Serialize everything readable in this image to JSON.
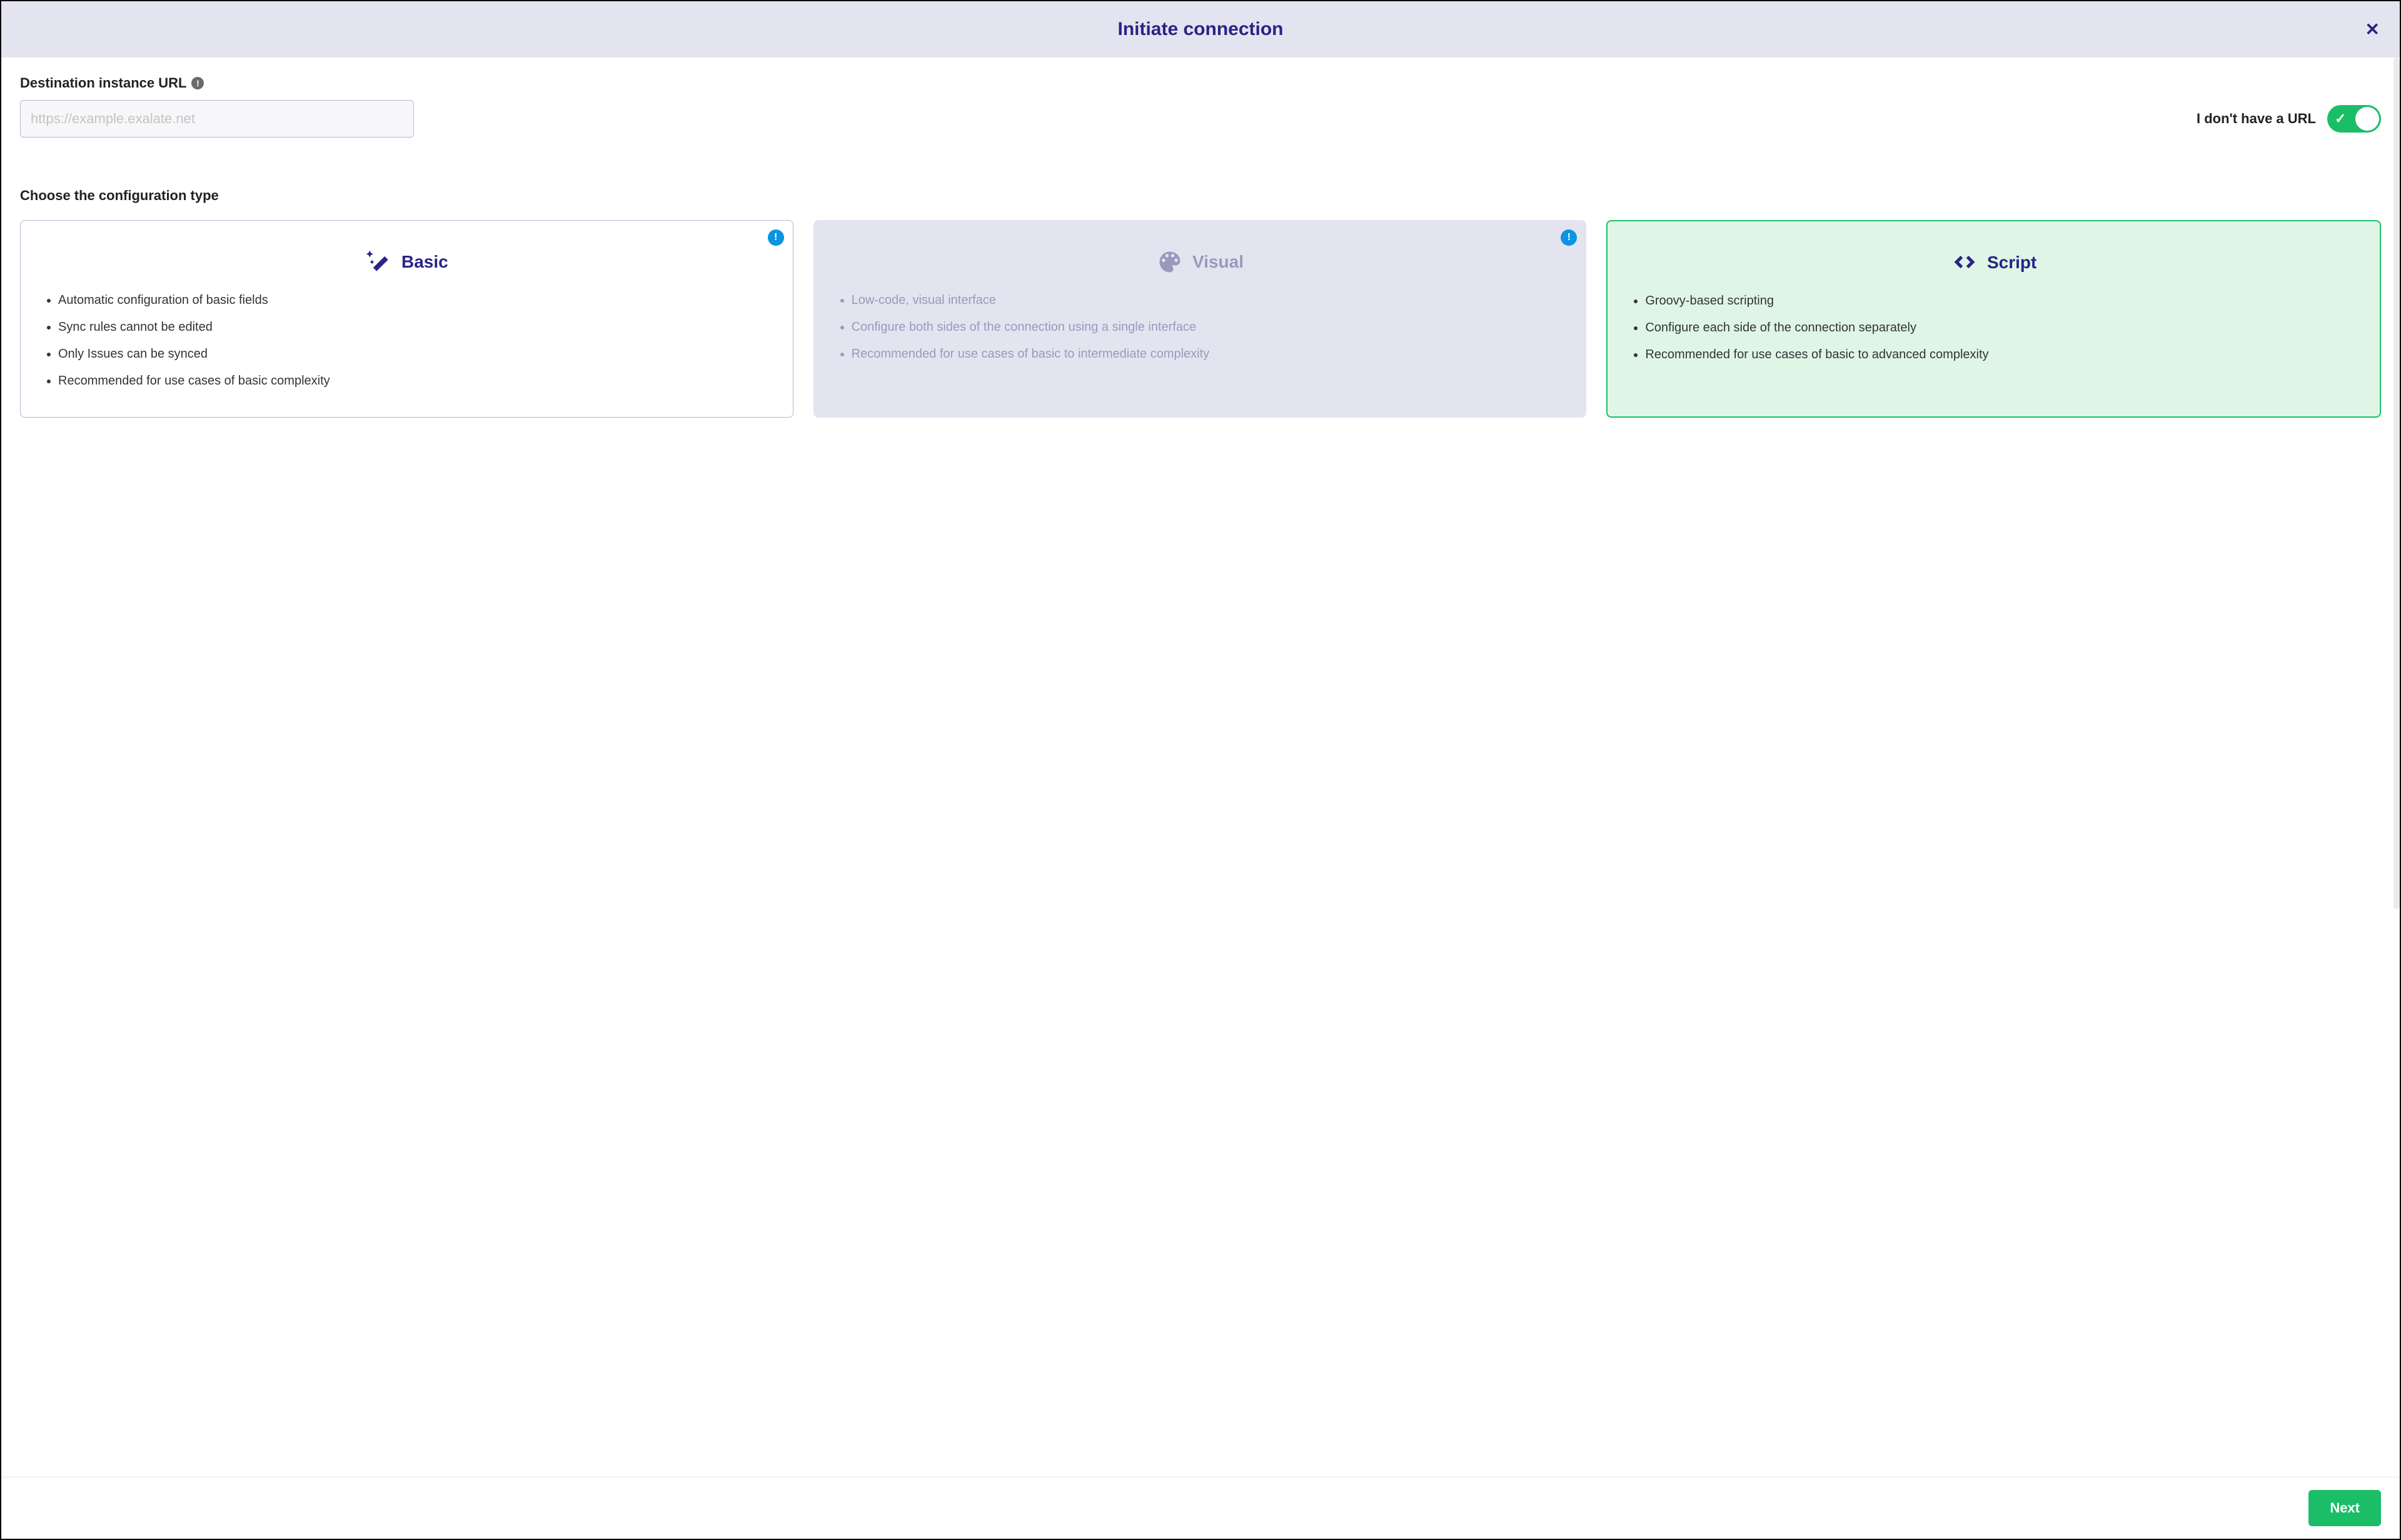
{
  "modal": {
    "title": "Initiate connection",
    "close": "✕"
  },
  "url_section": {
    "label": "Destination instance URL",
    "placeholder": "https://example.exalate.net",
    "no_url_label": "I don't have a URL",
    "toggle_on": true
  },
  "config_section": {
    "label": "Choose the configuration type"
  },
  "cards": {
    "basic": {
      "title": "Basic",
      "bullets": [
        "Automatic configuration of basic fields",
        "Sync rules cannot be edited",
        "Only Issues can be synced",
        "Recommended for use cases of basic complexity"
      ]
    },
    "visual": {
      "title": "Visual",
      "bullets": [
        "Low-code, visual interface",
        "Configure both sides of the connection using a single interface",
        "Recommended for use cases of basic to intermediate complexity"
      ]
    },
    "script": {
      "title": "Script",
      "bullets": [
        "Groovy-based scripting",
        "Configure each side of the connection separately",
        "Recommended for use cases of basic to advanced complexity"
      ]
    }
  },
  "footer": {
    "next": "Next"
  },
  "info_glyph": "!"
}
